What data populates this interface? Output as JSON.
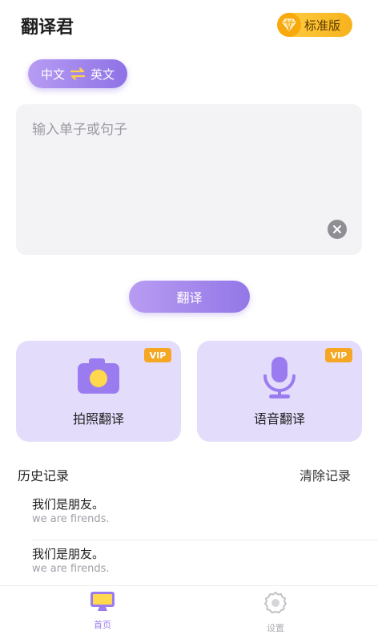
{
  "header": {
    "title": "翻译君",
    "badge_label": "标准版"
  },
  "language": {
    "source": "中文",
    "target": "英文"
  },
  "input": {
    "placeholder": "输入单子或句子",
    "value": ""
  },
  "translate_button": "翻译",
  "features": [
    {
      "label": "拍照翻译",
      "badge": "VIP",
      "icon": "camera-icon"
    },
    {
      "label": "语音翻译",
      "badge": "VIP",
      "icon": "microphone-icon"
    }
  ],
  "history": {
    "title": "历史记录",
    "clear_label": "清除记录",
    "items": [
      {
        "source": "我们是朋友。",
        "translation": "we are firends."
      },
      {
        "source": "我们是朋友。",
        "translation": "we are firends."
      }
    ]
  },
  "tabbar": {
    "home": "首页",
    "settings": "设置"
  },
  "colors": {
    "accent": "#9a7cf0",
    "card_bg": "#e4dcfb",
    "vip": "#f5a623",
    "badge": "#f8b51f"
  }
}
